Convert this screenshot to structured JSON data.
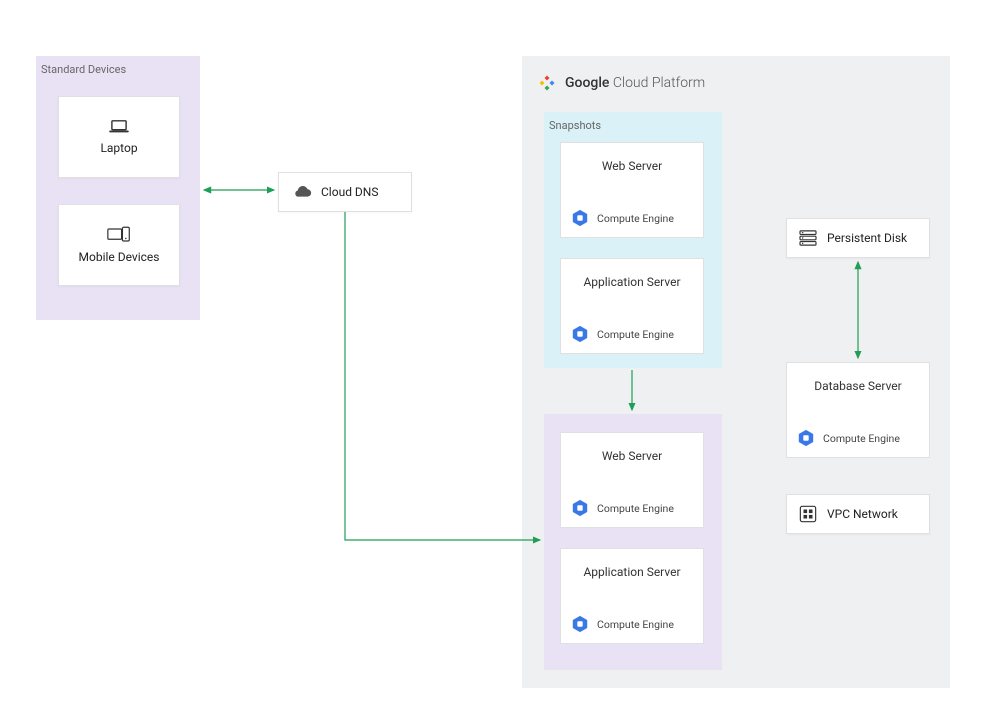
{
  "groups": {
    "devices": {
      "title": "Standard Devices"
    },
    "gcp": {
      "title_bold": "Google",
      "title_mid": " Cloud ",
      "title_thin": "Platform"
    },
    "snapshots": {
      "title": "Snapshots"
    }
  },
  "nodes": {
    "laptop": {
      "label": "Laptop"
    },
    "mobile": {
      "label": "Mobile Devices"
    },
    "dns": {
      "label": "Cloud DNS"
    },
    "pdisk": {
      "label": "Persistent Disk"
    },
    "vpc": {
      "label": "VPC Network"
    }
  },
  "servers": {
    "web1": {
      "title": "Web Server",
      "sub": "Compute Engine"
    },
    "app1": {
      "title": "Application Server",
      "sub": "Compute Engine"
    },
    "web2": {
      "title": "Web Server",
      "sub": "Compute Engine"
    },
    "app2": {
      "title": "Application Server",
      "sub": "Compute Engine"
    },
    "db": {
      "title": "Database Server",
      "sub": "Compute Engine"
    }
  },
  "colors": {
    "arrow": "#1f9e55",
    "groupDevices": "#e9e1f4",
    "groupGcp": "#eef0f2",
    "groupSnapshots": "#d9f1f7",
    "hexFill": "#3b78e7"
  }
}
